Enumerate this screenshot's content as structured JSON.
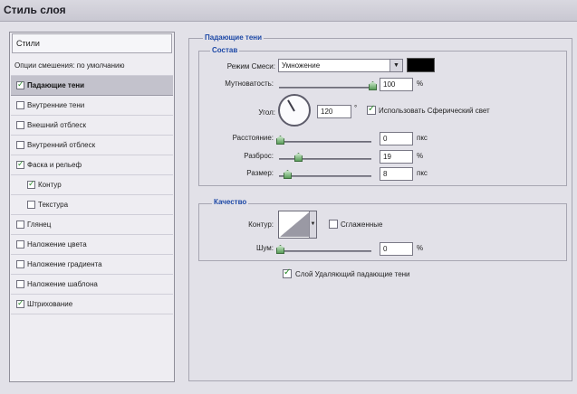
{
  "window": {
    "title": "Стиль слоя"
  },
  "styles_list": {
    "header": "Стили",
    "blending_options": "Опции смешения: по умолчанию",
    "items": [
      {
        "label": "Падающие тени",
        "checked": true,
        "selected": true
      },
      {
        "label": "Внутренние тени",
        "checked": false
      },
      {
        "label": "Внешний отблеск",
        "checked": false
      },
      {
        "label": "Внутренний отблеск",
        "checked": false
      },
      {
        "label": "Фаска и рельеф",
        "checked": true
      },
      {
        "label": "Контур",
        "checked": true
      },
      {
        "label": "Текстура",
        "checked": false
      },
      {
        "label": "Глянец",
        "checked": false
      },
      {
        "label": "Наложение цвета",
        "checked": false
      },
      {
        "label": "Наложение градиента",
        "checked": false
      },
      {
        "label": "Наложение шаблона",
        "checked": false
      },
      {
        "label": "Штрихование",
        "checked": true
      }
    ]
  },
  "drop_shadow": {
    "title": "Падающие тени",
    "structure": {
      "title": "Состав",
      "blend_mode_label": "Режим Смеси:",
      "blend_mode_value": "Умножение",
      "shadow_color": "#000000",
      "opacity_label": "Мутноватость:",
      "opacity_value": "100",
      "opacity_unit": "%",
      "opacity_level": 1.0,
      "angle_label": "Угол:",
      "angle_value": "120",
      "angle_unit": "°",
      "global_light_label": "Использовать Сферический свет",
      "global_light_checked": true,
      "distance_label": "Расстояние:",
      "distance_value": "0",
      "distance_unit": "пкс",
      "distance_level": 0.0,
      "spread_label": "Разброс:",
      "spread_value": "19",
      "spread_unit": "%",
      "spread_level": 0.19,
      "size_label": "Размер:",
      "size_value": "8",
      "size_unit": "пкс",
      "size_level": 0.03
    },
    "quality": {
      "title": "Качество",
      "contour_label": "Контур:",
      "antialiased_label": "Сглаженные",
      "antialiased_checked": false,
      "noise_label": "Шум:",
      "noise_value": "0",
      "noise_unit": "%",
      "noise_level": 0.0
    },
    "layer_knocks_out_label": "Слой Удаляющий падающие тени",
    "layer_knocks_out_checked": true
  },
  "icons": {
    "checkbox": "check-mark",
    "dropdown": "chevron-down",
    "angle": "angle-dial",
    "slider": "slider-thumb"
  },
  "colors": {
    "section_title": "#1e49a6",
    "check_mark": "#2a8a2a",
    "slider_thumb": "#5a9e5a"
  }
}
